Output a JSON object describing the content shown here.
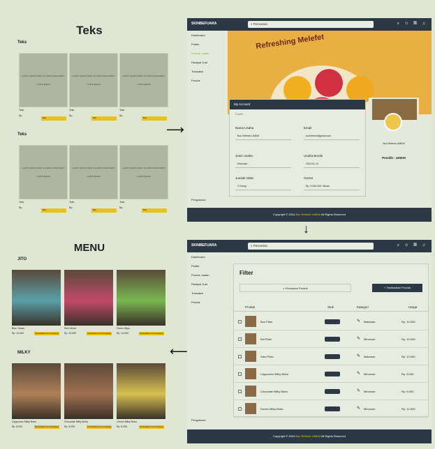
{
  "wireframe": {
    "title": "Teks",
    "sections": [
      "Teks",
      "Teks"
    ],
    "placeholder_top": "Lorem ipsum dolor sit amet consectetur",
    "placeholder_bottom": "Lorem ipsum",
    "card_name": "Teks",
    "card_price": "Rp",
    "card_button": "Beli"
  },
  "brand": "SKINBEFUARA",
  "search_placeholder": "Pencarian",
  "sidebar": {
    "items": [
      "Dashboard",
      "Profile",
      "Produk Jualan",
      "Riwayat Jual",
      "Transaksi",
      "Produk",
      "Pengaturan"
    ]
  },
  "banner_text": "Refreshing Melefet",
  "account": {
    "header": "My Account",
    "subtitle": "Profile",
    "fields": [
      {
        "label": "Nama Usaha",
        "value": "Bon Refresh UMKM"
      },
      {
        "label": "Email",
        "value": "bonrefresh@gmail.com"
      },
      {
        "label": "Jenis Usaha",
        "value": "Minuman"
      },
      {
        "label": "Usaha Berdiri",
        "value": "2024-01-10"
      },
      {
        "label": "Jumlah SDM",
        "value": "3 Orang"
      },
      {
        "label": "Omzet",
        "value": "Rp. 3.000.000 / Bulan"
      }
    ],
    "profile_name": "Bon Refresh UMKM",
    "profile_role": "Pemilik - UMKM"
  },
  "footer": {
    "prefix": "Copyright © 2024",
    "highlight": "Bon Refresh UMKM",
    "suffix": "All Rights Reserved"
  },
  "products": {
    "filter_title": "Filter",
    "search_placeholder": "Pencarian Produk",
    "add_button": "+ Tambahkan Produk",
    "headers": [
      "Produk",
      "Stok",
      "Kategori",
      "Harga"
    ],
    "rows": [
      {
        "name": "Bon Plain",
        "category": "Makanan",
        "price": "Rp. 10.000"
      },
      {
        "name": "Bol Plain",
        "category": "Minuman",
        "price": "Rp. 10.000"
      },
      {
        "name": "Gato Plain",
        "category": "Makanan",
        "price": "Rp. 10.000"
      },
      {
        "name": "Cappucino Milky Boba",
        "category": "Minuman",
        "price": "Rp. 8.000"
      },
      {
        "name": "Chocolate Milky Boba",
        "category": "Minuman",
        "price": "Rp. 8.000"
      },
      {
        "name": "Durian Milky Boba",
        "category": "Minuman",
        "price": "Rp. 12.000"
      }
    ]
  },
  "menu": {
    "title": "MENU",
    "sections": [
      {
        "name": "JITO",
        "items": [
          {
            "name": "Blue Ocean",
            "price": "Rp. 10.000",
            "color": "#5aa0a8"
          },
          {
            "name": "Red Velvet",
            "price": "Rp. 10.000",
            "color": "#c24a6a"
          },
          {
            "name": "Green Hijau",
            "price": "Rp. 10.000",
            "color": "#7ab850"
          }
        ]
      },
      {
        "name": "MILKY",
        "items": [
          {
            "name": "Cappucino Milky Boba",
            "price": "Rp. 8.000",
            "color": "#b08058"
          },
          {
            "name": "Chocolate Milky Boba",
            "price": "Rp. 8.000",
            "color": "#a07050"
          },
          {
            "name": "Lemon Milky Boba",
            "price": "Rp. 8.000",
            "color": "#d6c050"
          }
        ]
      }
    ],
    "button": "Tambahkan ke Keranjang"
  },
  "colors": {
    "dark": "#2c3944",
    "accent": "#e8c21a",
    "bg": "#dfe6d3"
  }
}
